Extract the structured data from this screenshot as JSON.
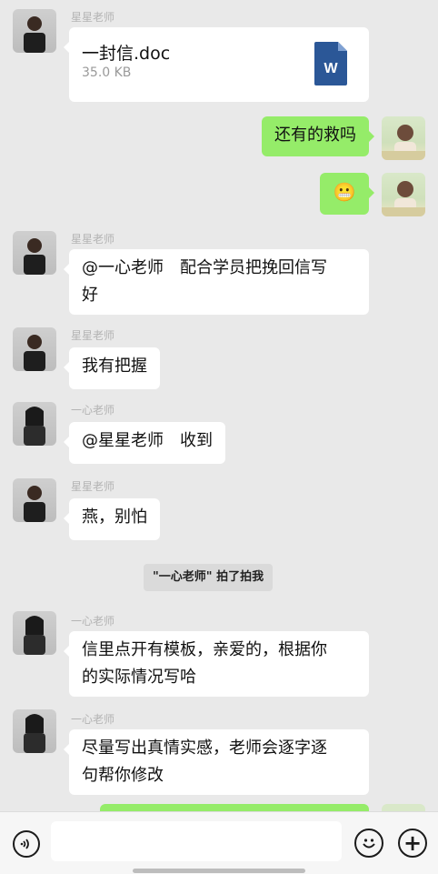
{
  "messages": {
    "file": {
      "sender": "星星老师",
      "file_name": "一封信.doc",
      "file_size": "35.0 KB",
      "icon": "word-document-icon"
    },
    "self_1": {
      "text": "还有的救吗"
    },
    "self_2": {
      "emoji": "😬"
    },
    "m1": {
      "sender": "星星老师",
      "text_line1": "@一心老师　配合学员把挽回信写",
      "text_line2": "好"
    },
    "m2": {
      "sender": "星星老师",
      "text": "我有把握"
    },
    "m3": {
      "sender": "一心老师",
      "text": "@星星老师　收到"
    },
    "m4": {
      "sender": "星星老师",
      "text": "燕，别怕"
    },
    "system": {
      "text": "\"一心老师\" 拍了拍我"
    },
    "m5": {
      "sender": "一心老师",
      "text_line1": "信里点开有模板，亲爱的，根据你",
      "text_line2": "的实际情况写哈"
    },
    "m6": {
      "sender": "一心老师",
      "text_line1": "尽量写出真情实感，老师会逐字逐",
      "text_line2": "句帮你修改"
    }
  },
  "input_bar": {
    "icons": {
      "voice": "voice-icon",
      "emoji": "emoji-icon",
      "plus": "plus-icon"
    },
    "plus_glyph": "+"
  },
  "colors": {
    "background": "#e9e9e9",
    "self_bubble": "#95ec69",
    "other_bubble": "#ffffff",
    "name_text": "#b3b3b3"
  }
}
